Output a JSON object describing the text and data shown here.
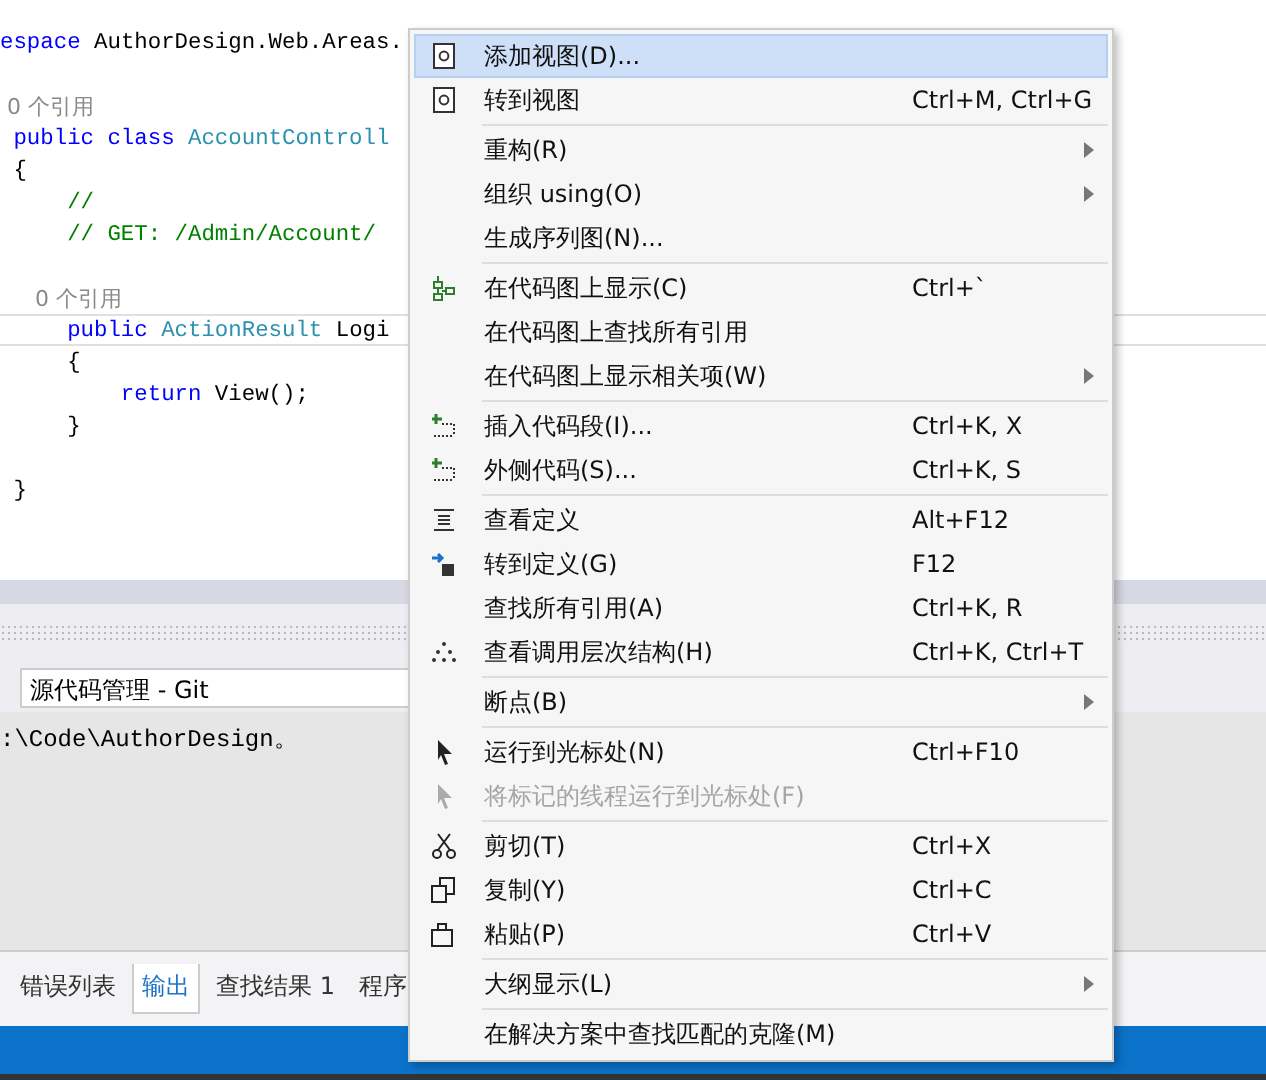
{
  "editor": {
    "lines": [
      {
        "current": false,
        "tokens": [
          {
            "kind": "keyword",
            "text": "espace"
          },
          {
            "kind": "plain",
            "text": " AuthorDesign.Web.Areas."
          }
        ]
      },
      {
        "current": false
      },
      {
        "current": false,
        "tokens": [
          {
            "kind": "hint",
            "text": " 0 个引用"
          }
        ]
      },
      {
        "current": false,
        "tokens": [
          {
            "kind": "keyword",
            "text": " public class"
          },
          {
            "kind": "type",
            "text": " AccountControll"
          }
        ]
      },
      {
        "current": false,
        "tokens": [
          {
            "kind": "plain",
            "text": " {"
          }
        ]
      },
      {
        "current": false,
        "tokens": [
          {
            "kind": "comment",
            "text": "     //"
          }
        ]
      },
      {
        "current": false,
        "tokens": [
          {
            "kind": "comment",
            "text": "     // GET: /Admin/Account/"
          }
        ]
      },
      {
        "current": false
      },
      {
        "current": false,
        "tokens": [
          {
            "kind": "hint",
            "text": "     0 个引用"
          }
        ]
      },
      {
        "current": true,
        "tokens": [
          {
            "kind": "keyword",
            "text": "     public"
          },
          {
            "kind": "type",
            "text": " ActionResult"
          },
          {
            "kind": "plain",
            "text": " Logi"
          }
        ]
      },
      {
        "current": false,
        "tokens": [
          {
            "kind": "plain",
            "text": "     {"
          }
        ]
      },
      {
        "current": false,
        "tokens": [
          {
            "kind": "keyword",
            "text": "         return"
          },
          {
            "kind": "plain",
            "text": " View();"
          }
        ]
      },
      {
        "current": false,
        "tokens": [
          {
            "kind": "plain",
            "text": "     }"
          }
        ]
      },
      {
        "current": false
      },
      {
        "current": false,
        "tokens": [
          {
            "kind": "plain",
            "text": " }"
          }
        ]
      }
    ]
  },
  "output": {
    "source": "源代码管理 - Git",
    "text": ":\\Code\\AuthorDesign。"
  },
  "tabs": [
    {
      "label": "错误列表",
      "selected": false
    },
    {
      "label": "输出",
      "selected": true
    },
    {
      "label": "查找结果 1",
      "selected": false
    },
    {
      "label": "程序",
      "selected": false
    }
  ],
  "menu": {
    "groups": [
      [
        {
          "kind": "view",
          "label": "添加视图(D)...",
          "submenu": false,
          "selected": true,
          "disabled": false
        },
        {
          "kind": "view",
          "label": "转到视图",
          "shortcut": "Ctrl+M, Ctrl+G",
          "submenu": false,
          "selected": false,
          "disabled": false
        }
      ],
      [
        {
          "kind": "plain",
          "label": "重构(R)",
          "submenu": true,
          "selected": false,
          "disabled": false
        },
        {
          "kind": "plain",
          "label": "组织 using(O)",
          "submenu": true,
          "selected": false,
          "disabled": false
        },
        {
          "kind": "plain",
          "label": "生成序列图(N)...",
          "submenu": false,
          "selected": false,
          "disabled": false
        }
      ],
      [
        {
          "kind": "map",
          "label": "在代码图上显示(C)",
          "shortcut": "Ctrl+`",
          "submenu": false,
          "selected": false,
          "disabled": false
        },
        {
          "kind": "plain",
          "label": "在代码图上查找所有引用",
          "submenu": false,
          "selected": false,
          "disabled": false
        },
        {
          "kind": "plain",
          "label": "在代码图上显示相关项(W)",
          "submenu": true,
          "selected": false,
          "disabled": false
        }
      ],
      [
        {
          "kind": "snippet",
          "label": "插入代码段(I)...",
          "shortcut": "Ctrl+K, X",
          "submenu": false,
          "selected": false,
          "disabled": false
        },
        {
          "kind": "snippet",
          "label": "外侧代码(S)...",
          "shortcut": "Ctrl+K, S",
          "submenu": false,
          "selected": false,
          "disabled": false
        }
      ],
      [
        {
          "kind": "peek",
          "label": "查看定义",
          "shortcut": "Alt+F12",
          "submenu": false,
          "selected": false,
          "disabled": false
        },
        {
          "kind": "goto",
          "label": "转到定义(G)",
          "shortcut": "F12",
          "submenu": false,
          "selected": false,
          "disabled": false
        },
        {
          "kind": "plain",
          "label": "查找所有引用(A)",
          "shortcut": "Ctrl+K, R",
          "submenu": false,
          "selected": false,
          "disabled": false
        },
        {
          "kind": "hierarchy",
          "label": "查看调用层次结构(H)",
          "shortcut": "Ctrl+K, Ctrl+T",
          "submenu": false,
          "selected": false,
          "disabled": false
        }
      ],
      [
        {
          "kind": "plain",
          "label": "断点(B)",
          "submenu": true,
          "selected": false,
          "disabled": false
        }
      ],
      [
        {
          "kind": "cursor",
          "label": "运行到光标处(N)",
          "shortcut": "Ctrl+F10",
          "submenu": false,
          "selected": false,
          "disabled": false
        },
        {
          "kind": "cursor",
          "label": "将标记的线程运行到光标处(F)",
          "submenu": false,
          "selected": false,
          "disabled": true
        }
      ],
      [
        {
          "kind": "cut",
          "label": "剪切(T)",
          "shortcut": "Ctrl+X",
          "submenu": false,
          "selected": false,
          "disabled": false
        },
        {
          "kind": "copy",
          "label": "复制(Y)",
          "shortcut": "Ctrl+C",
          "submenu": false,
          "selected": false,
          "disabled": false
        },
        {
          "kind": "paste",
          "label": "粘贴(P)",
          "shortcut": "Ctrl+V",
          "submenu": false,
          "selected": false,
          "disabled": false
        }
      ],
      [
        {
          "kind": "plain",
          "label": "大纲显示(L)",
          "submenu": true,
          "selected": false,
          "disabled": false
        }
      ],
      [
        {
          "kind": "plain",
          "label": "在解决方案中查找匹配的克隆(M)",
          "submenu": false,
          "selected": false,
          "disabled": false
        }
      ]
    ]
  }
}
